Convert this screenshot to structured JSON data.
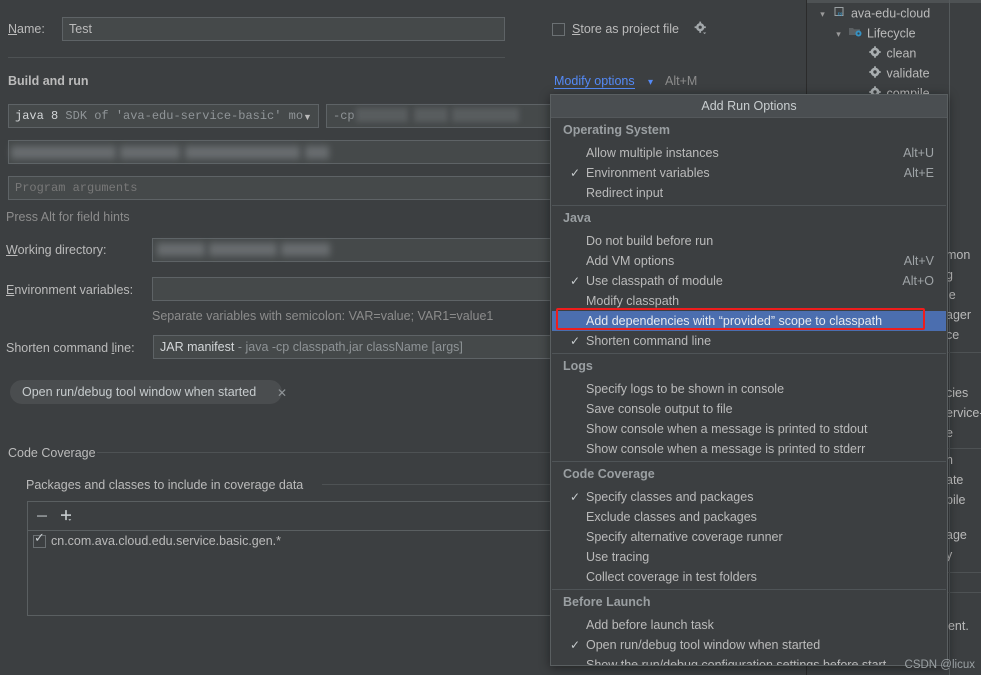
{
  "form": {
    "name_label": "Name:",
    "name_value": "Test",
    "store_as_project_file_label": "Store as project file",
    "store_as_project_file_checked": false,
    "gear_icon": "gear-icon",
    "build_and_run_title": "Build and run",
    "modify_options_link": "Modify options",
    "modify_options_shortcut": "Alt+M",
    "jre_combo_value_bold": "java 8",
    "jre_combo_value_rest": "SDK of 'ava-edu-service-basic' mo",
    "vm_options_prefix": "-cp",
    "program_arguments_placeholder": "Program arguments",
    "field_hints": "Press Alt for field hints",
    "working_directory_label": "Working directory:",
    "environment_variables_label": "Environment variables:",
    "environment_variables_value": "",
    "env_hint": "Separate variables with semicolon: VAR=value; VAR1=value1",
    "shorten_command_line_label": "Shorten command line:",
    "shorten_command_line_value_bold": "JAR manifest",
    "shorten_command_line_value_rest": "- java -cp classpath.jar className [args]",
    "chip_label": "Open run/debug tool window when started",
    "chip_close_icon": "close-icon",
    "code_coverage_title": "Code Coverage",
    "coverage_packages_title": "Packages and classes to include in coverage data",
    "coverage_remove_icon": "minus-icon",
    "coverage_add_icon": "plus-icon",
    "coverage_rows": [
      {
        "checked": true,
        "value": "cn.com.ava.cloud.edu.service.basic.gen.*"
      }
    ]
  },
  "popup": {
    "title": "Add Run Options",
    "highlight_color": "#4b6eaf",
    "red_outline_color": "#ee1d1d",
    "sections": [
      {
        "name": "Operating System",
        "items": [
          {
            "label": "Allow multiple instances",
            "checked": false,
            "shortcut": "Alt+U",
            "selected": false
          },
          {
            "label": "Environment variables",
            "checked": true,
            "shortcut": "Alt+E",
            "selected": false
          },
          {
            "label": "Redirect input",
            "checked": false,
            "shortcut": "",
            "selected": false
          }
        ]
      },
      {
        "name": "Java",
        "items": [
          {
            "label": "Do not build before run",
            "checked": false,
            "shortcut": "",
            "selected": false
          },
          {
            "label": "Add VM options",
            "checked": false,
            "shortcut": "Alt+V",
            "selected": false
          },
          {
            "label": "Use classpath of module",
            "checked": true,
            "shortcut": "Alt+O",
            "selected": false
          },
          {
            "label": "Modify classpath",
            "checked": false,
            "shortcut": "",
            "selected": false
          },
          {
            "label": "Add dependencies with “provided” scope to classpath",
            "checked": false,
            "shortcut": "",
            "selected": true
          },
          {
            "label": "Shorten command line",
            "checked": true,
            "shortcut": "",
            "selected": false
          }
        ]
      },
      {
        "name": "Logs",
        "items": [
          {
            "label": "Specify logs to be shown in console",
            "checked": false,
            "shortcut": "",
            "selected": false
          },
          {
            "label": "Save console output to file",
            "checked": false,
            "shortcut": "",
            "selected": false
          },
          {
            "label": "Show console when a message is printed to stdout",
            "checked": false,
            "shortcut": "",
            "selected": false
          },
          {
            "label": "Show console when a message is printed to stderr",
            "checked": false,
            "shortcut": "",
            "selected": false
          }
        ]
      },
      {
        "name": "Code Coverage",
        "items": [
          {
            "label": "Specify classes and packages",
            "checked": true,
            "shortcut": "",
            "selected": false
          },
          {
            "label": "Exclude classes and packages",
            "checked": false,
            "shortcut": "",
            "selected": false
          },
          {
            "label": "Specify alternative coverage runner",
            "checked": false,
            "shortcut": "",
            "selected": false
          },
          {
            "label": "Use tracing",
            "checked": false,
            "shortcut": "",
            "selected": false
          },
          {
            "label": "Collect coverage in test folders",
            "checked": false,
            "shortcut": "",
            "selected": false
          }
        ]
      },
      {
        "name": "Before Launch",
        "items": [
          {
            "label": "Add before launch task",
            "checked": false,
            "shortcut": "",
            "selected": false
          },
          {
            "label": "Open run/debug tool window when started",
            "checked": true,
            "shortcut": "",
            "selected": false
          },
          {
            "label": "Show the run/debug configuration settings before start",
            "checked": false,
            "shortcut": "",
            "selected": false
          }
        ]
      }
    ]
  },
  "maven_tree": [
    {
      "label": "ava-edu-cloud",
      "depth": 0,
      "expanded": true,
      "icon": "maven-project-icon"
    },
    {
      "label": "Lifecycle",
      "depth": 1,
      "expanded": true,
      "icon": "lifecycle-folder-icon"
    },
    {
      "label": "clean",
      "depth": 2,
      "expanded": null,
      "icon": "maven-goal-icon"
    },
    {
      "label": "validate",
      "depth": 2,
      "expanded": null,
      "icon": "maven-goal-icon"
    },
    {
      "label": "compile",
      "depth": 2,
      "expanded": null,
      "icon": "maven-goal-icon"
    }
  ],
  "right_strip_lines": [
    "mon",
    "g",
    "le",
    "ager",
    "ce",
    "cies",
    "ervice-",
    "e",
    "n",
    "ate",
    "pile",
    "age",
    "y"
  ],
  "right_strip_agent": "gent.",
  "watermark": "CSDN @licux"
}
